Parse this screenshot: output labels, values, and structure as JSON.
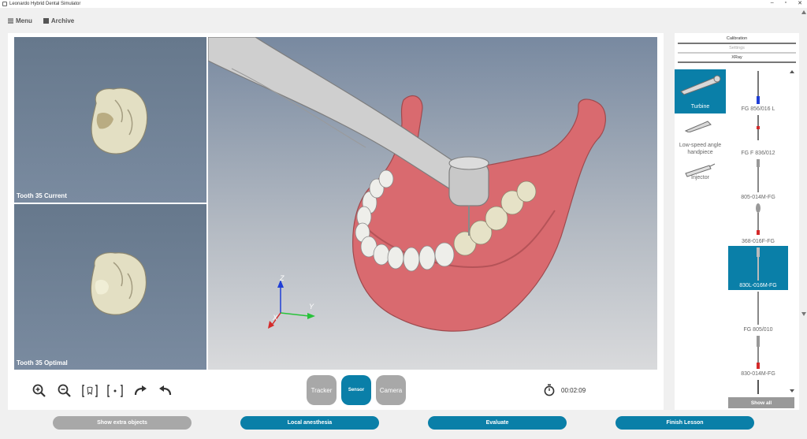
{
  "window": {
    "title": "Leonardo Hybrid Dental Simulator",
    "minimize": "–",
    "maximize": "▫",
    "close": "✕"
  },
  "menu": {
    "menu_label": "Menu",
    "archive_label": "Archive"
  },
  "views": {
    "current_label": "Tooth 35 Current",
    "optimal_label": "Tooth 35 Optimal"
  },
  "axes": {
    "x": "X",
    "y": "Y",
    "z": "Z"
  },
  "modes": {
    "tracker": "Tracker",
    "sensor": "Sensor",
    "camera": "Camera",
    "active": "Sensor"
  },
  "timer": {
    "value": "00:02:09"
  },
  "right_tabs": {
    "calibration": "Calibration",
    "settings": "Settings",
    "xray": "XRay"
  },
  "tools": [
    {
      "label": "Turbine",
      "selected": true
    },
    {
      "label": "Low-speed angle handpiece",
      "selected": false
    },
    {
      "label": "Injector",
      "selected": false
    }
  ],
  "burs": [
    {
      "label": "FG 856/016 L",
      "selected": false
    },
    {
      "label": "FG F 836/012",
      "selected": false
    },
    {
      "label": "805-014M-FG",
      "selected": false
    },
    {
      "label": "368-016F-FG",
      "selected": false
    },
    {
      "label": "830L-016M-FG",
      "selected": true
    },
    {
      "label": "FG 805/010",
      "selected": false
    },
    {
      "label": "830-014M-FG",
      "selected": false
    }
  ],
  "show_all_label": "Show all",
  "bottom": {
    "extra_objects": "Show extra objects",
    "local_anesthesia": "Local anesthesia",
    "evaluate": "Evaluate",
    "finish": "Finish Lesson"
  },
  "colors": {
    "accent": "#0a7fa8",
    "inactive": "#a8a8a8",
    "gum": "#d96a6f",
    "tooth": "#e6e2c7"
  }
}
